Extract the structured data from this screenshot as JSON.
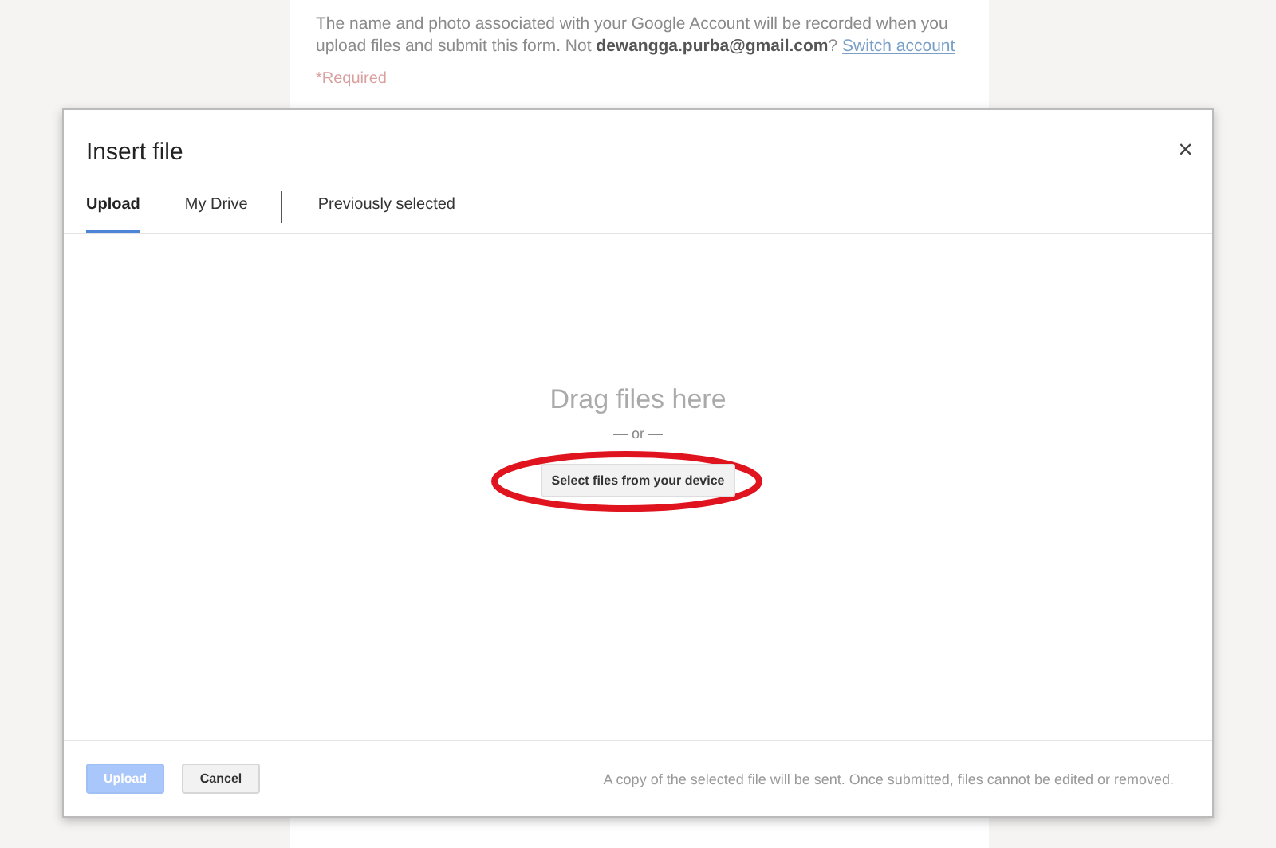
{
  "form": {
    "notice": "The name and photo associated with your Google Account will be recorded when you upload files and submit this form. Not **dewangga.purba@gmail.com**?",
    "switch_link": "Switch account",
    "required": "*Required"
  },
  "dialog": {
    "title": "Insert file",
    "close": "×",
    "tabs": [
      {
        "label": "Upload",
        "selected": true
      },
      {
        "label": "My Drive",
        "selected": false
      },
      {
        "label": "Previously selected",
        "selected": false
      }
    ],
    "drop_text": "Drag files here",
    "or_text": "— or —",
    "select_button": "Select files from your device",
    "select_highlighted": true,
    "buttons": [
      {
        "label": "Upload",
        "disabled": true
      },
      {
        "label": "Cancel",
        "disabled": false
      }
    ],
    "footer_note": "A copy of the selected file will be sent. Once submitted, files cannot be edited or removed."
  }
}
